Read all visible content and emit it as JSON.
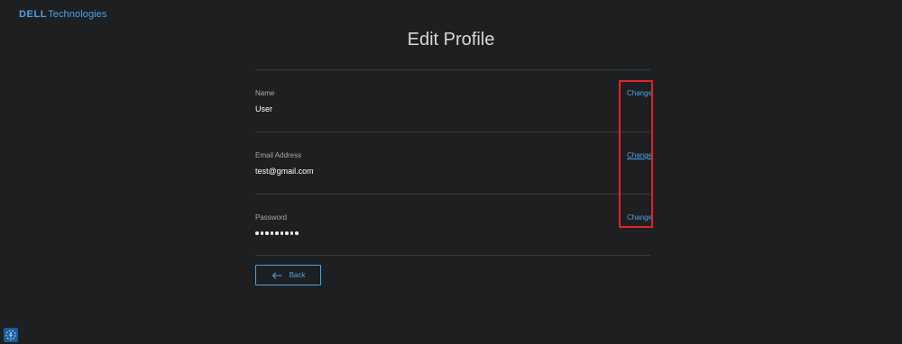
{
  "header": {
    "logo_brand": "DELL",
    "logo_suffix": "Technologies"
  },
  "page": {
    "title": "Edit Profile"
  },
  "fields": [
    {
      "label": "Name",
      "value": "User",
      "action": "Change"
    },
    {
      "label": "Email Address",
      "value": "test@gmail.com",
      "action": "Change"
    },
    {
      "label": "Password",
      "value": "•••••••••",
      "action": "Change"
    }
  ],
  "footer": {
    "back_label": "Back"
  },
  "icons": {
    "back": "arrow-left-icon",
    "helper": "accessibility-icon"
  },
  "colors": {
    "background": "#1e1f21",
    "accent": "#4aa3e8",
    "highlight": "#e0242a"
  }
}
